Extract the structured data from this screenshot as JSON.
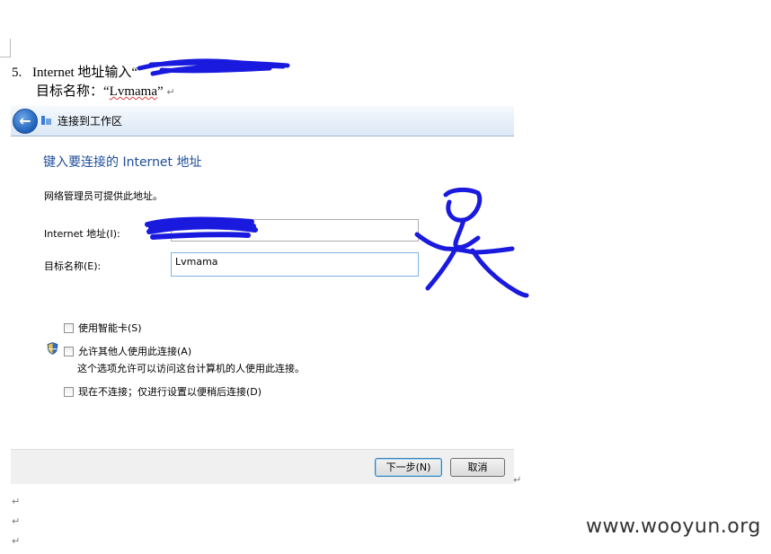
{
  "document": {
    "step_number": "5.",
    "step_prefix": "Internet 地址输入“",
    "step_visible_tail": "”",
    "line2_prefix": "目标名称：“",
    "line2_value": "Lvmama",
    "line2_suffix": "”",
    "return_mark": "↵"
  },
  "dialog": {
    "back_glyph": "←",
    "window_title": "连接到工作区",
    "heading": "键入要连接的 Internet 地址",
    "description": "网络管理员可提供此地址。",
    "internet_address": {
      "label": "Internet 地址(I):",
      "value": ""
    },
    "target_name": {
      "label": "目标名称(E):",
      "value": "Lvmama"
    },
    "checkboxes": [
      {
        "label": "使用智能卡(S)",
        "checked": false
      },
      {
        "label": "允许其他人使用此连接(A)",
        "checked": false,
        "has_shield": true,
        "note": "这个选项允许可以访问这台计算机的人使用此连接。"
      },
      {
        "label": "现在不连接；仅进行设置以便稍后连接(D)",
        "checked": false
      }
    ],
    "buttons": {
      "next": "下一步(N)",
      "cancel": "取消"
    }
  },
  "watermark": "www.wooyun.org",
  "colors": {
    "scribble": "#1a1adf",
    "heading": "#1e4d9a"
  }
}
